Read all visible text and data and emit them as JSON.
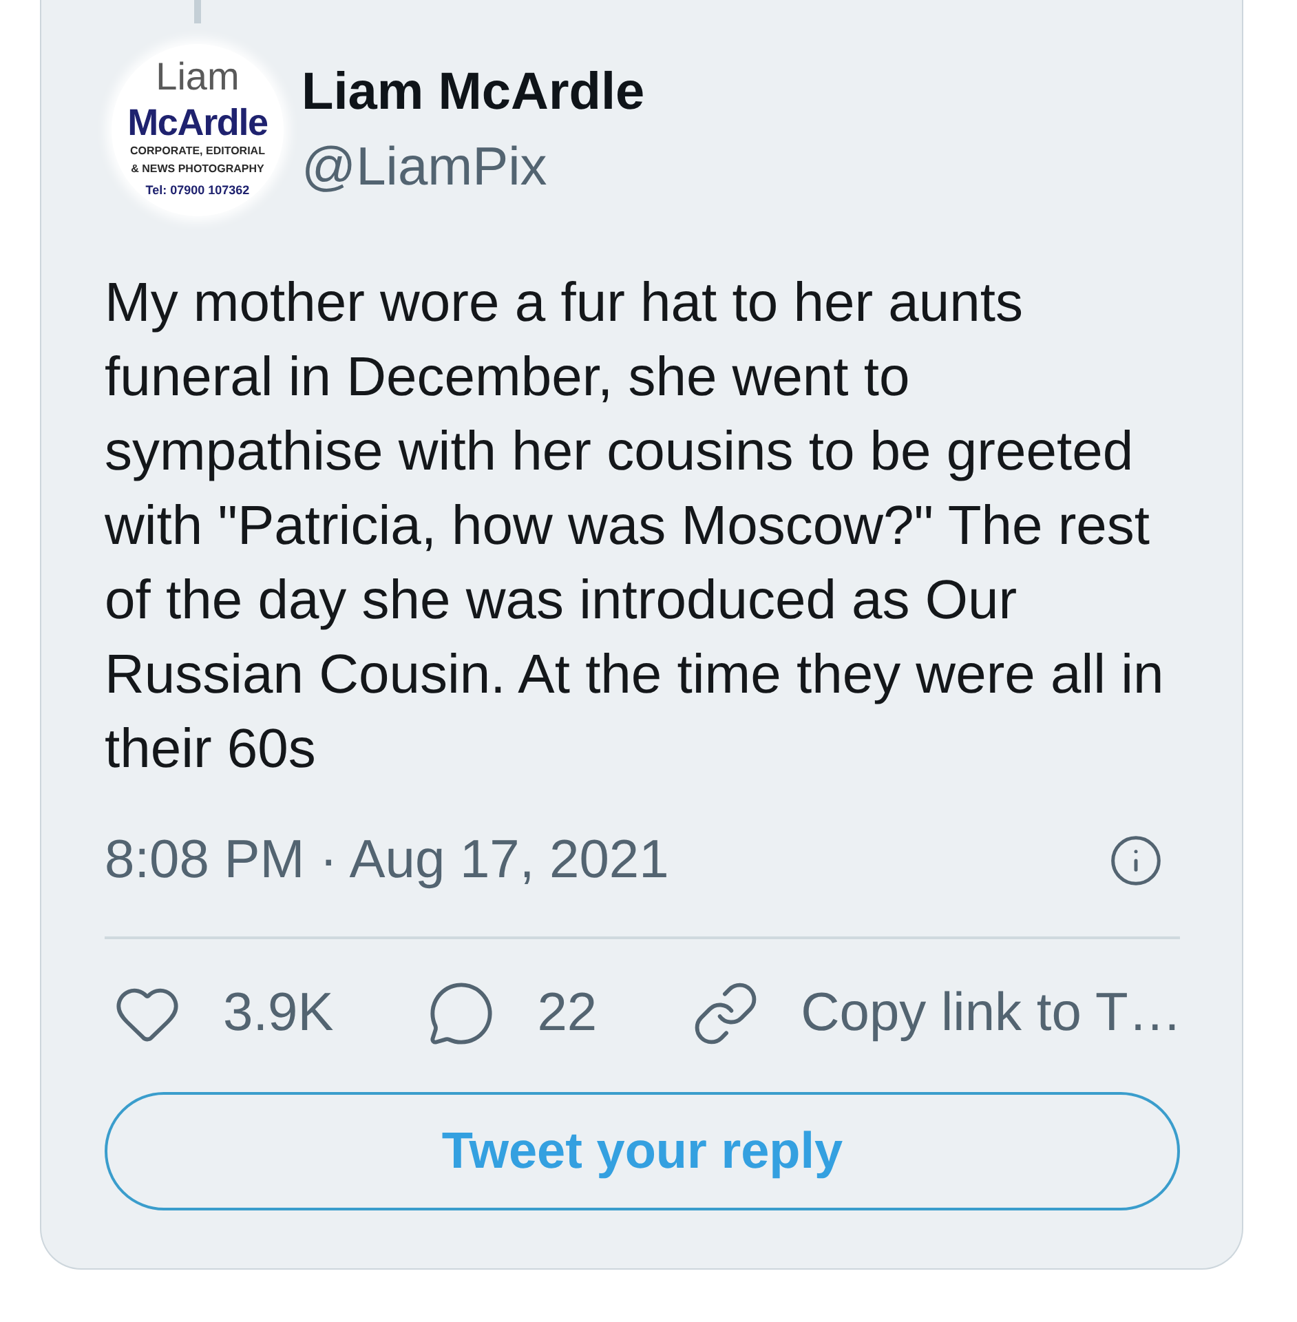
{
  "avatar": {
    "logo_lines": [
      "Liam",
      "McArdle",
      "CORPORATE, EDITORIAL",
      "& NEWS PHOTOGRAPHY",
      "Tel: 07900 107362"
    ]
  },
  "author": {
    "name": "Liam McArdle",
    "handle": "@LiamPix"
  },
  "tweet": {
    "text": "My mother wore a fur hat to her aunts funeral in December, she went to sympathise with her cousins to be greeted with \"Patricia, how was Moscow?\" The rest of the day she was introduced as Our Russian Cousin. At the time they were all in their 60s",
    "timestamp": "8:08 PM · Aug 17, 2021"
  },
  "actions": [
    {
      "kind": "like",
      "label": "3.9K"
    },
    {
      "kind": "reply",
      "label": "22"
    },
    {
      "kind": "share",
      "label": "Copy link to T…"
    }
  ],
  "reply_button": {
    "label": "Tweet your reply"
  }
}
